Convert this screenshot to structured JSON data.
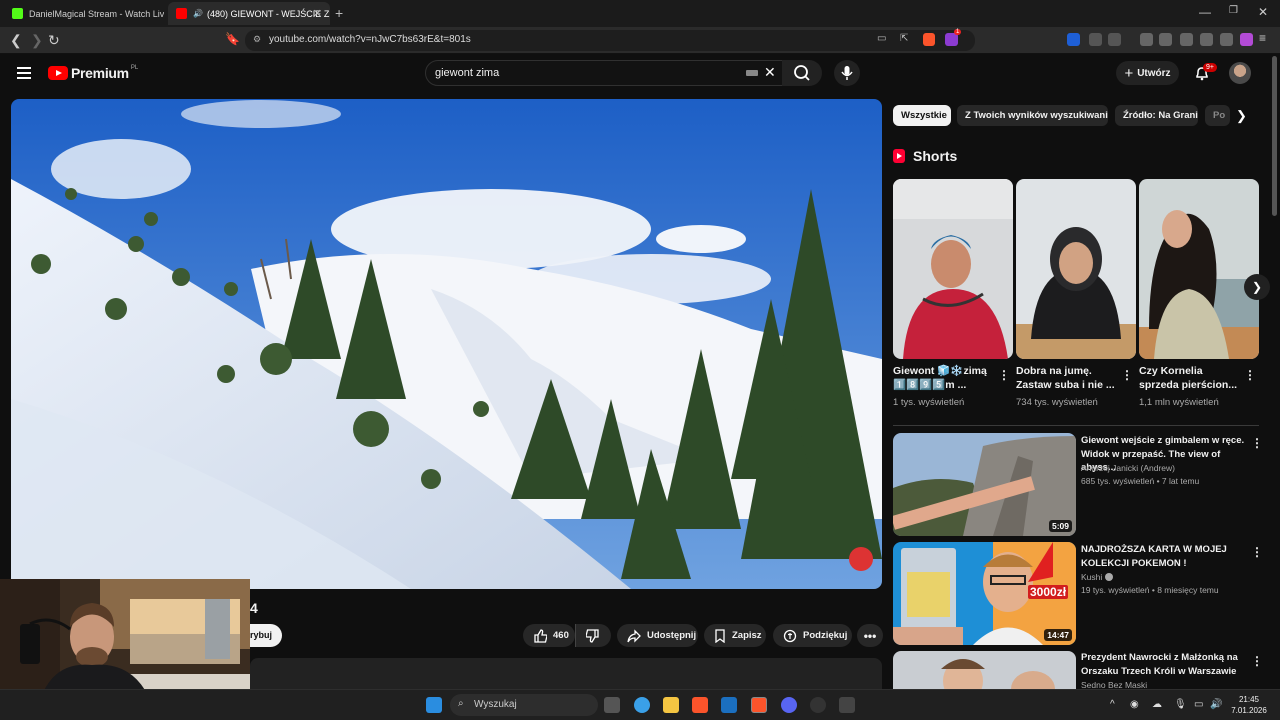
{
  "browser": {
    "tabs": [
      {
        "label": "DanielMagical Stream - Watch Live o",
        "active": false
      },
      {
        "label": "(480) GIEWONT - WEJŚCIE ZI",
        "active": true
      }
    ],
    "url": "youtube.com/watch?v=nJwC7bs63rE&t=801s",
    "brave_badge": "1"
  },
  "header": {
    "logo_text": "Premium",
    "logo_region": "PL",
    "search_value": "giewont zima",
    "create_label": "Utwórz",
    "notif_badge": "9+"
  },
  "player": {
    "title_fragment": "4",
    "subscribe_fragment": "rybuj",
    "like_count": "460",
    "share_label": "Udostępnij",
    "save_label": "Zapisz",
    "thanks_label": "Podziękuj"
  },
  "chips": [
    "Wszystkie",
    "Z Twoich wyników wyszukiwania",
    "Źródło: Na Grani",
    "Po"
  ],
  "shorts": {
    "heading": "Shorts",
    "items": [
      {
        "title": "Giewont 🧊❄️zimą 1️⃣8️⃣9️⃣5️⃣m ...",
        "views": "1 tys. wyświetleń"
      },
      {
        "title": "Dobra na jumę. Zastaw suba i nie ...",
        "views": "734 tys. wyświetleń"
      },
      {
        "title": "Czy Kornelia sprzeda pierścion...",
        "views": "1,1 mln wyświetleń"
      }
    ]
  },
  "recommendations": [
    {
      "title": "Giewont wejście  z gimbalem w ręce. Widok w przepaść. The view of abyss...",
      "channel": "Andrzej Janicki (Andrew)",
      "meta": "685 tys. wyświetleń • 7 lat temu",
      "duration": "5:09",
      "verified": false
    },
    {
      "title": "NAJDROŻSZA KARTA W MOJEJ KOLEKCJI POKEMON !",
      "channel": "Kushi",
      "meta": "19 tys. wyświetleń • 8 miesięcy temu",
      "duration": "14:47",
      "verified": true,
      "thumb_text": "3000zł"
    },
    {
      "title": "Prezydent Nawrocki z Małżonką na Orszaku Trzech Króli w Warszawie",
      "channel": "Sedno Bez Maski",
      "meta": "",
      "duration": "",
      "verified": false
    }
  ],
  "taskbar": {
    "search_placeholder": "Wyszukaj",
    "time": "21:45",
    "date": "7.01.2026"
  },
  "colors": {
    "yt_red": "#ff0000",
    "bg": "#0f0f0f",
    "chip_bg": "#272727"
  }
}
